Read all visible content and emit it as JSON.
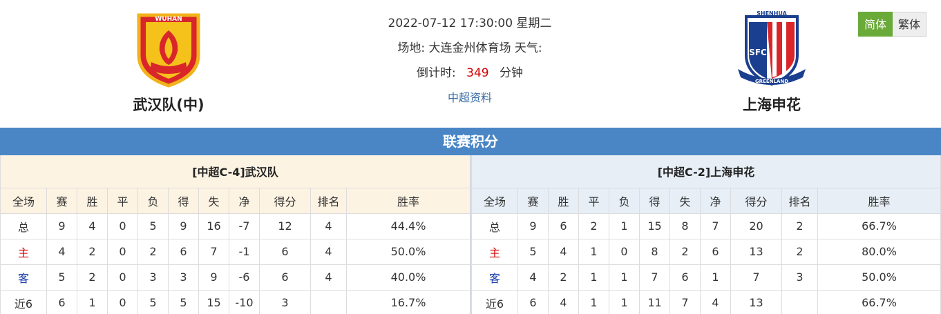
{
  "match": {
    "datetime": "2022-07-12 17:30:00 星期二",
    "venue_label": "场地:",
    "venue": "大连金州体育场",
    "weather_label": "天气:",
    "weather": "",
    "countdown_label": "倒计时:",
    "countdown_value": "349",
    "countdown_unit": "分钟",
    "league_link": "中超资料"
  },
  "home_team": {
    "name": "武汉队(中)",
    "logo_text": "WUHAN",
    "logo_icon": "wuhan-phoenix-crest"
  },
  "away_team": {
    "name": "上海申花",
    "logo_text_top": "SHENHUA",
    "logo_text_mid": "SFC",
    "logo_text_bottom": "GREENLAND",
    "logo_icon": "shenhua-shield-crest"
  },
  "lang": {
    "simplified": "简体",
    "traditional": "繁体"
  },
  "section_title": "联赛积分",
  "standings": {
    "columns": [
      "全场",
      "赛",
      "胜",
      "平",
      "负",
      "得",
      "失",
      "净",
      "得分",
      "排名",
      "胜率"
    ],
    "home": {
      "caption": "[中超C-4]武汉队",
      "rows": [
        [
          "总",
          "9",
          "4",
          "0",
          "5",
          "9",
          "16",
          "-7",
          "12",
          "4",
          "44.4%"
        ],
        [
          "主",
          "4",
          "2",
          "0",
          "2",
          "6",
          "7",
          "-1",
          "6",
          "4",
          "50.0%"
        ],
        [
          "客",
          "5",
          "2",
          "0",
          "3",
          "3",
          "9",
          "-6",
          "6",
          "4",
          "40.0%"
        ],
        [
          "近6",
          "6",
          "1",
          "0",
          "5",
          "5",
          "15",
          "-10",
          "3",
          "",
          "16.7%"
        ]
      ]
    },
    "away": {
      "caption": "[中超C-2]上海申花",
      "rows": [
        [
          "总",
          "9",
          "6",
          "2",
          "1",
          "15",
          "8",
          "7",
          "20",
          "2",
          "66.7%"
        ],
        [
          "主",
          "5",
          "4",
          "1",
          "0",
          "8",
          "2",
          "6",
          "13",
          "2",
          "80.0%"
        ],
        [
          "客",
          "4",
          "2",
          "1",
          "1",
          "7",
          "6",
          "1",
          "7",
          "3",
          "50.0%"
        ],
        [
          "近6",
          "6",
          "4",
          "1",
          "1",
          "11",
          "7",
          "4",
          "13",
          "",
          "66.7%"
        ]
      ]
    }
  },
  "colors": {
    "title_bar": "#4a86c6",
    "active_lang": "#6aaa39",
    "countdown": "#d10000",
    "home_label": "#d10000",
    "away_label": "#1a3ea8"
  }
}
